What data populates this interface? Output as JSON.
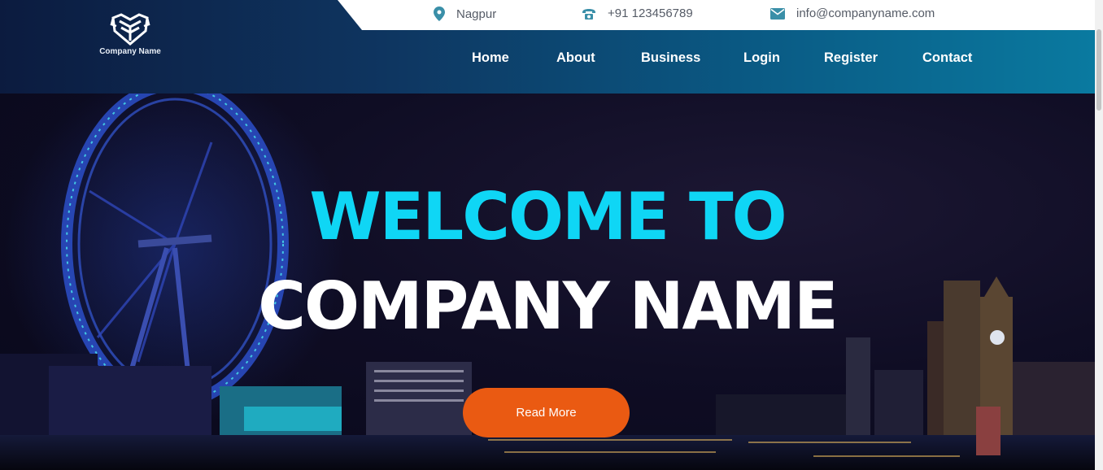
{
  "brand": {
    "name": "Company Name",
    "logo_icon": "crest-logo-icon"
  },
  "topbar": {
    "location": {
      "icon": "map-pin-icon",
      "text": "Nagpur"
    },
    "phone": {
      "icon": "phone-icon",
      "text": "+91 123456789"
    },
    "email": {
      "icon": "envelope-icon",
      "text": "info@companyname.com"
    }
  },
  "nav": {
    "items": [
      "Home",
      "About",
      "Business",
      "Login",
      "Register",
      "Contact"
    ]
  },
  "hero": {
    "title_line1": "WELCOME TO",
    "title_line2": "COMPANY NAME",
    "button_label": "Read More"
  },
  "colors": {
    "accent_cyan": "#0fd6f5",
    "button_orange": "#ea5a12",
    "header_dark": "#0c1b3f",
    "header_teal": "#0a7aa0",
    "icon_teal": "#3a8fa8"
  }
}
